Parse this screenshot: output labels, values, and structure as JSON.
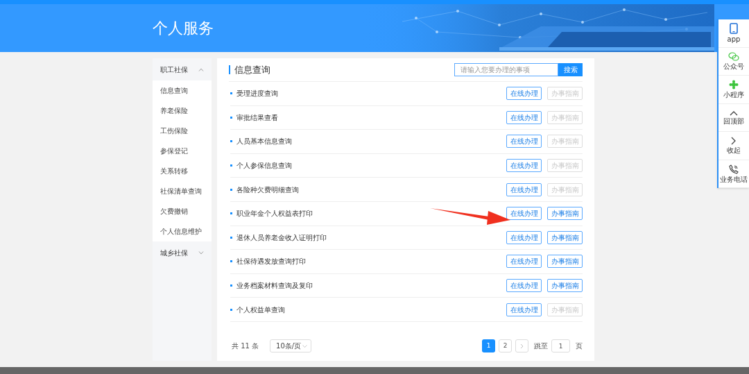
{
  "header": {
    "title": "个人服务"
  },
  "sidebar": {
    "sections": [
      {
        "label": "职工社保",
        "expanded": true,
        "children": [
          {
            "label": "信息查询"
          },
          {
            "label": "养老保险"
          },
          {
            "label": "工伤保险"
          },
          {
            "label": "参保登记"
          },
          {
            "label": "关系转移"
          },
          {
            "label": "社保清单查询"
          },
          {
            "label": "欠费撤销"
          },
          {
            "label": "个人信息维护"
          }
        ]
      },
      {
        "label": "城乡社保",
        "expanded": false
      }
    ]
  },
  "panel": {
    "title": "信息查询",
    "search": {
      "placeholder": "请输入您要办理的事项",
      "button": "搜索"
    }
  },
  "items": [
    {
      "label": "受理进度查询",
      "actions": [
        {
          "label": "在线办理",
          "disabled": false
        },
        {
          "label": "办事指南",
          "disabled": true
        }
      ]
    },
    {
      "label": "审批结果查看",
      "actions": [
        {
          "label": "在线办理",
          "disabled": false
        },
        {
          "label": "办事指南",
          "disabled": true
        }
      ]
    },
    {
      "label": "人员基本信息查询",
      "actions": [
        {
          "label": "在线办理",
          "disabled": false
        },
        {
          "label": "办事指南",
          "disabled": true
        }
      ]
    },
    {
      "label": "个人参保信息查询",
      "actions": [
        {
          "label": "在线办理",
          "disabled": false
        },
        {
          "label": "办事指南",
          "disabled": true
        }
      ]
    },
    {
      "label": "各险种欠费明细查询",
      "actions": [
        {
          "label": "在线办理",
          "disabled": false
        },
        {
          "label": "办事指南",
          "disabled": true
        }
      ]
    },
    {
      "label": "职业年金个人权益表打印",
      "actions": [
        {
          "label": "在线办理",
          "disabled": false
        },
        {
          "label": "办事指南",
          "disabled": false
        }
      ]
    },
    {
      "label": "退休人员养老金收入证明打印",
      "actions": [
        {
          "label": "在线办理",
          "disabled": false
        },
        {
          "label": "办事指南",
          "disabled": false
        }
      ]
    },
    {
      "label": "社保待遇发放查询打印",
      "actions": [
        {
          "label": "在线办理",
          "disabled": false
        },
        {
          "label": "办事指南",
          "disabled": false
        }
      ]
    },
    {
      "label": "业务档案材料查询及复印",
      "actions": [
        {
          "label": "在线办理",
          "disabled": false
        },
        {
          "label": "办事指南",
          "disabled": false
        }
      ]
    },
    {
      "label": "个人权益单查询",
      "actions": [
        {
          "label": "在线办理",
          "disabled": false
        },
        {
          "label": "办事指南",
          "disabled": true
        }
      ]
    }
  ],
  "pagination": {
    "total": "共 11 条",
    "page_size": "10条/页",
    "pages": [
      {
        "label": "1",
        "selected": true
      },
      {
        "label": "2",
        "selected": false
      }
    ],
    "jump_label": "跳至",
    "jump_value": "1",
    "page_unit": "页"
  },
  "side_tools": [
    {
      "label": "app",
      "kind": "phone"
    },
    {
      "label": "公众号",
      "kind": "wechat"
    },
    {
      "label": "小程序",
      "kind": "miniprogram"
    },
    {
      "label": "回顶部",
      "kind": "up"
    },
    {
      "label": "收起",
      "kind": "collapse"
    },
    {
      "label": "业务电话",
      "kind": "call"
    }
  ]
}
